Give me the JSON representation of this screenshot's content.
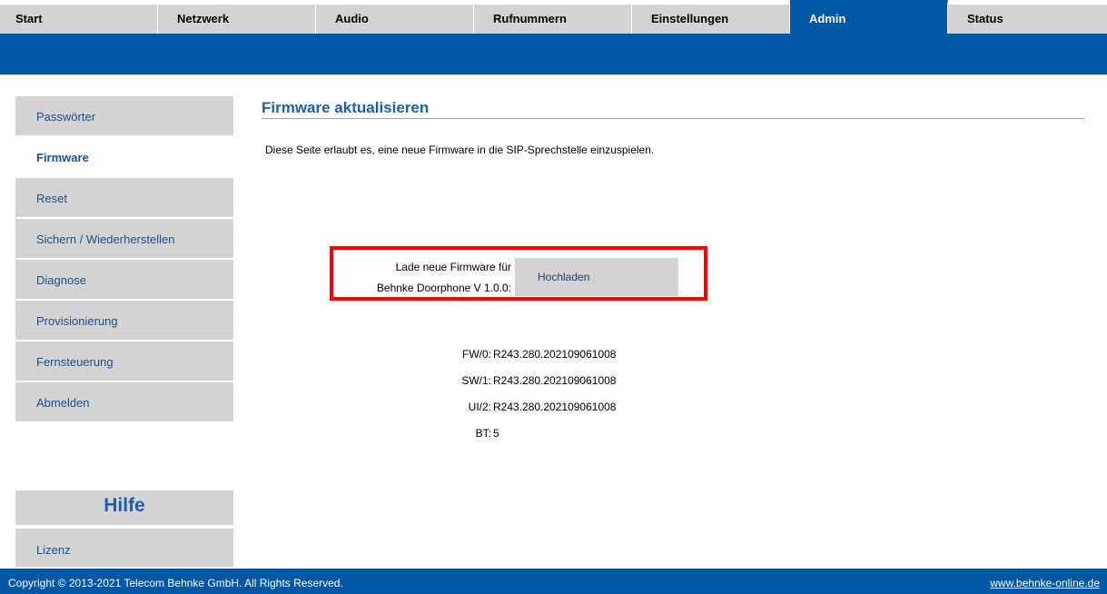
{
  "nav": {
    "tabs": [
      {
        "label": "Start"
      },
      {
        "label": "Netzwerk"
      },
      {
        "label": "Audio"
      },
      {
        "label": "Rufnummern"
      },
      {
        "label": "Einstellungen"
      },
      {
        "label": "Admin"
      },
      {
        "label": "Status"
      }
    ],
    "active": "Admin"
  },
  "sidebar": {
    "items": [
      {
        "label": "Passwörter"
      },
      {
        "label": "Firmware"
      },
      {
        "label": "Reset"
      },
      {
        "label": "Sichern / Wiederherstellen"
      },
      {
        "label": "Diagnose"
      },
      {
        "label": "Provisionierung"
      },
      {
        "label": "Fernsteuerung"
      },
      {
        "label": "Abmelden"
      }
    ],
    "active": "Firmware",
    "help_heading": "Hilfe",
    "license_label": "Lizenz"
  },
  "main": {
    "title": "Firmware aktualisieren",
    "description": "Diese Seite erlaubt es, eine neue Firmware in die SIP-Sprechstelle einzuspielen.",
    "upload": {
      "label_line1": "Lade neue Firmware für",
      "label_line2": "Behnke Doorphone V 1.0.0:",
      "button_label": "Hochladen"
    },
    "versions": [
      {
        "key": "FW/0:",
        "value": "R243.280.202109061008"
      },
      {
        "key": "SW/1:",
        "value": "R243.280.202109061008"
      },
      {
        "key": "UI/2:",
        "value": "R243.280.202109061008"
      },
      {
        "key": "BT:",
        "value": "5"
      }
    ]
  },
  "footer": {
    "copyright": "Copyright © 2013-2021 Telecom Behnke GmbH. All Rights Reserved.",
    "link": "www.behnke-online.de"
  },
  "colors": {
    "brand_blue": "#0057a4",
    "tab_gray": "#d3d3d3",
    "highlight_red": "#ff0000"
  }
}
